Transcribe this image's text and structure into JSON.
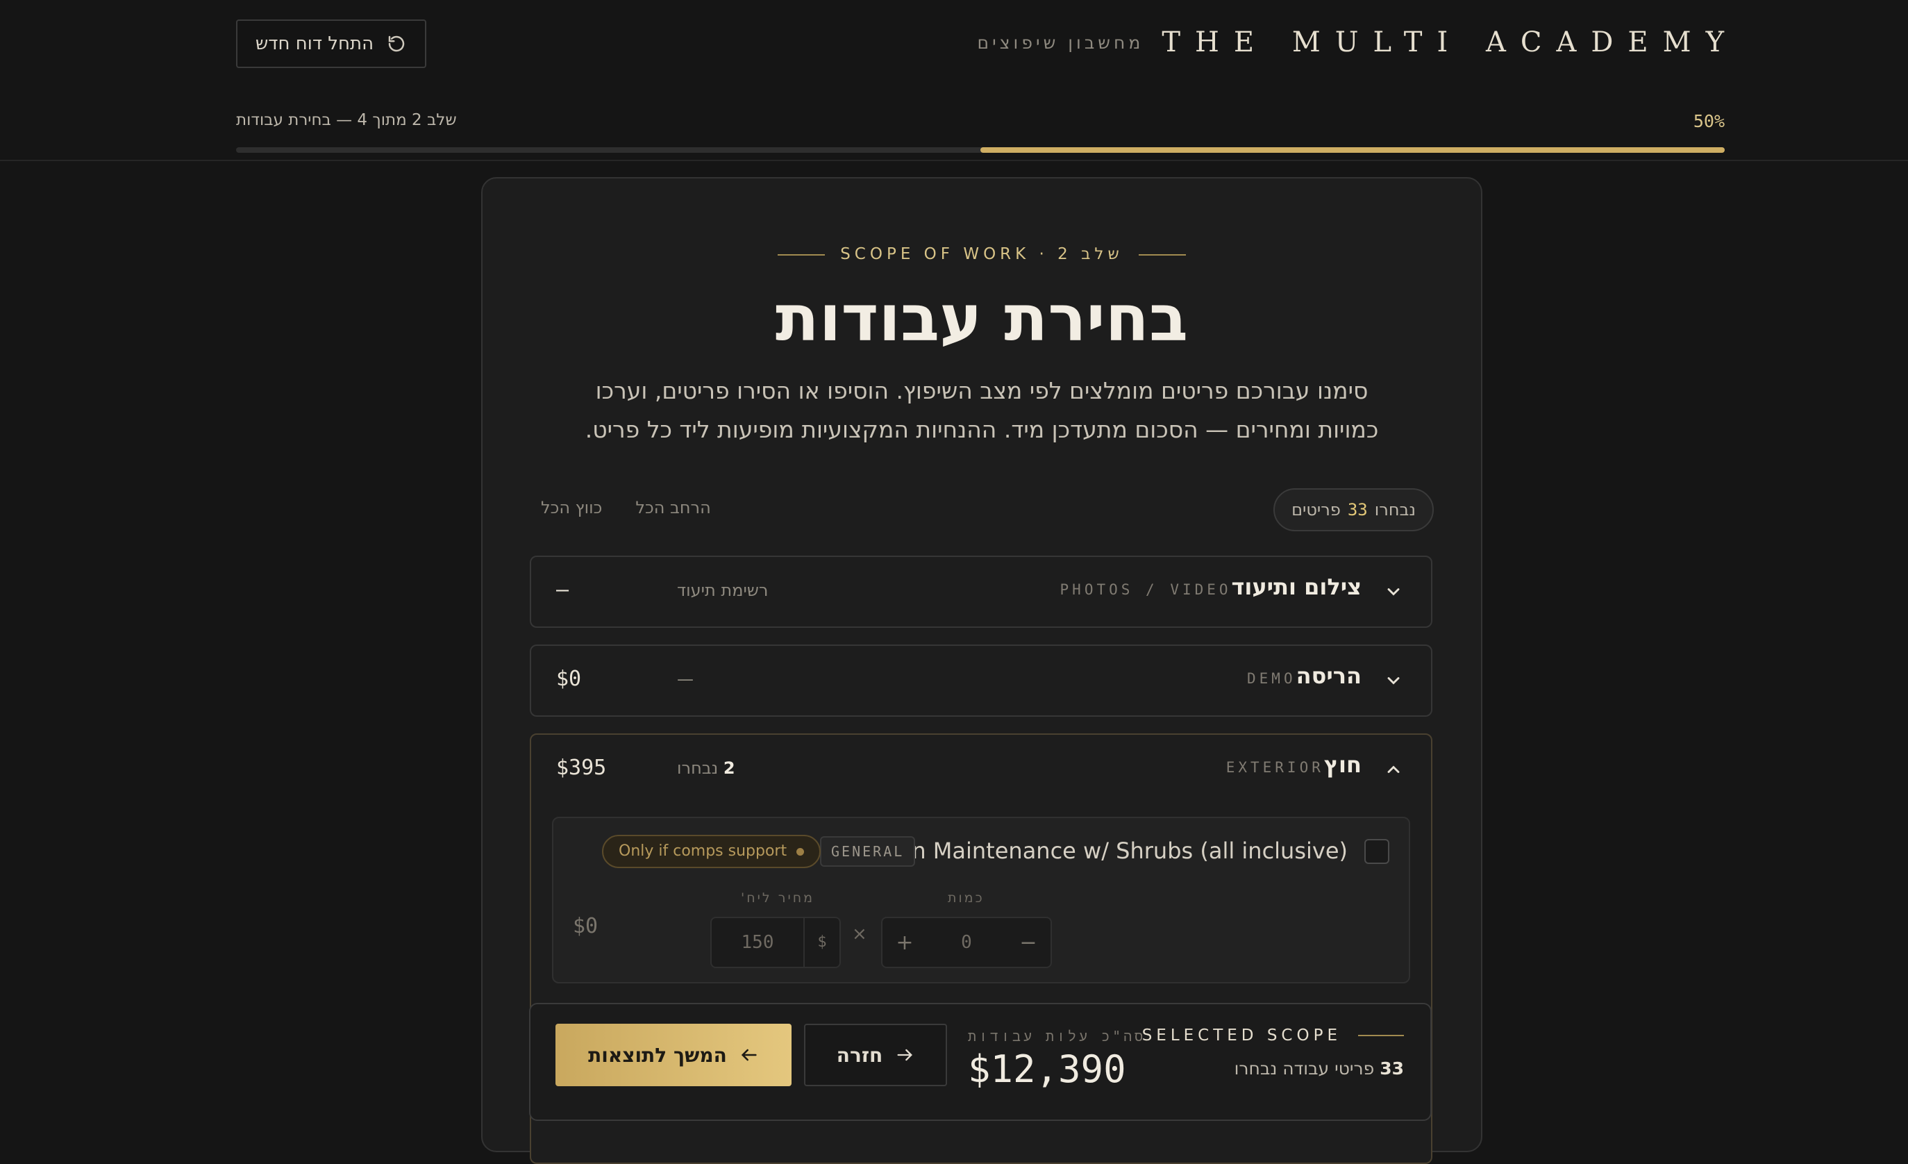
{
  "header": {
    "brand_name": "THE MULTI ACADEMY",
    "brand_subtitle": "מחשבון שיפוצים",
    "restart_label": "התחל דוח חדש",
    "progress_text": "שלב 2 מתוך 4 — בחירת עבודות",
    "progress_percent_label": "50%",
    "progress_fraction": 0.5
  },
  "main": {
    "eyebrow": "שלב 2 · SCOPE OF WORK",
    "title": "בחירת עבודות",
    "description": "סימנו עבורכם פריטים מומלצים לפי מצב השיפוץ. הוסיפו או הסירו פריטים, וערכו כמויות ומחירים — הסכום מתעדכן מיד. ההנחיות המקצועיות מופיעות ליד כל פריט.",
    "selected_pill": {
      "prefix": "נבחרו",
      "count": "33",
      "suffix": "פריטים"
    },
    "expand_all": "הרחב הכל",
    "collapse_all": "כווץ הכל"
  },
  "sections": [
    {
      "title": "צילום ותיעוד",
      "en": "PHOTOS / VIDEO",
      "meta": "רשימת תיעוד",
      "total": "—"
    },
    {
      "title": "הריסה",
      "en": "DEMO",
      "meta": "—",
      "total": "$0"
    },
    {
      "title": "חוץ",
      "en": "EXTERIOR",
      "meta_count": "2",
      "meta": "נבחרו",
      "total": "$395"
    }
  ],
  "item": {
    "name": "Lawn Maintenance w/ Shrubs (all inclusive)",
    "tag": "GENERAL",
    "badge": "Only if comps support",
    "total": "$0",
    "price_label": "מחיר ליח'",
    "price": "150",
    "currency": "$",
    "times": "×",
    "qty_label": "כמות",
    "qty": "0",
    "plus": "+",
    "minus": "−"
  },
  "summary": {
    "eyebrow": "SELECTED SCOPE",
    "count": "33",
    "count_label": "פריטי עבודה נבחרו",
    "total_label": "סה\"כ עלות עבודות",
    "total": "$12,390",
    "back_label": "חזרה",
    "next_label": "המשך לתוצאות"
  },
  "colors": {
    "accent": "#cfae63",
    "background": "#151515",
    "card": "#1d1d1d"
  }
}
